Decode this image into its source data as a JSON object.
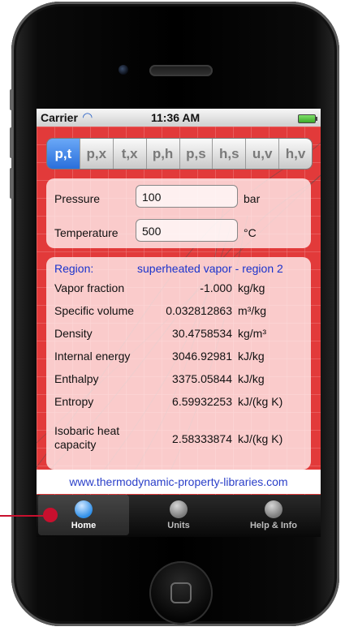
{
  "status_bar": {
    "carrier": "Carrier",
    "time": "11:36 AM"
  },
  "tabs": [
    {
      "label": "p,t",
      "active": true
    },
    {
      "label": "p,x",
      "active": false
    },
    {
      "label": "t,x",
      "active": false
    },
    {
      "label": "p,h",
      "active": false
    },
    {
      "label": "p,s",
      "active": false
    },
    {
      "label": "h,s",
      "active": false
    },
    {
      "label": "u,v",
      "active": false
    },
    {
      "label": "h,v",
      "active": false
    }
  ],
  "inputs": {
    "pressure": {
      "label": "Pressure",
      "value": "100",
      "unit": "bar"
    },
    "temperature": {
      "label": "Temperature",
      "value": "500",
      "unit": "°C"
    }
  },
  "results": {
    "region": {
      "label": "Region:",
      "value": "superheated vapor - region 2"
    },
    "rows": [
      {
        "label": "Vapor fraction",
        "value": "-1.000",
        "unit": "kg/kg"
      },
      {
        "label": "Specific volume",
        "value": "0.032812863",
        "unit": "m³/kg"
      },
      {
        "label": "Density",
        "value": "30.4758534",
        "unit": "kg/m³"
      },
      {
        "label": "Internal energy",
        "value": "3046.92981",
        "unit": "kJ/kg"
      },
      {
        "label": "Enthalpy",
        "value": "3375.05844",
        "unit": "kJ/kg"
      },
      {
        "label": "Entropy",
        "value": "6.59932253",
        "unit": "kJ/(kg K)"
      },
      {
        "label": "Isobaric heat capacity",
        "value": "2.58333874",
        "unit": "kJ/(kg K)"
      }
    ]
  },
  "footer_link": "www.thermodynamic-property-libraries.com",
  "tab_bar": [
    {
      "label": "Home",
      "icon": "home-icon",
      "active": true
    },
    {
      "label": "Units",
      "icon": "units-icon",
      "active": false
    },
    {
      "label": "Help & Info",
      "icon": "help-icon",
      "active": false
    }
  ],
  "colors": {
    "screen_bg": "#e23a3a",
    "active_tab": "#2a6fdb",
    "link": "#2a3fc9",
    "region_text": "#1a33cc",
    "annotation": "#c8102e"
  }
}
